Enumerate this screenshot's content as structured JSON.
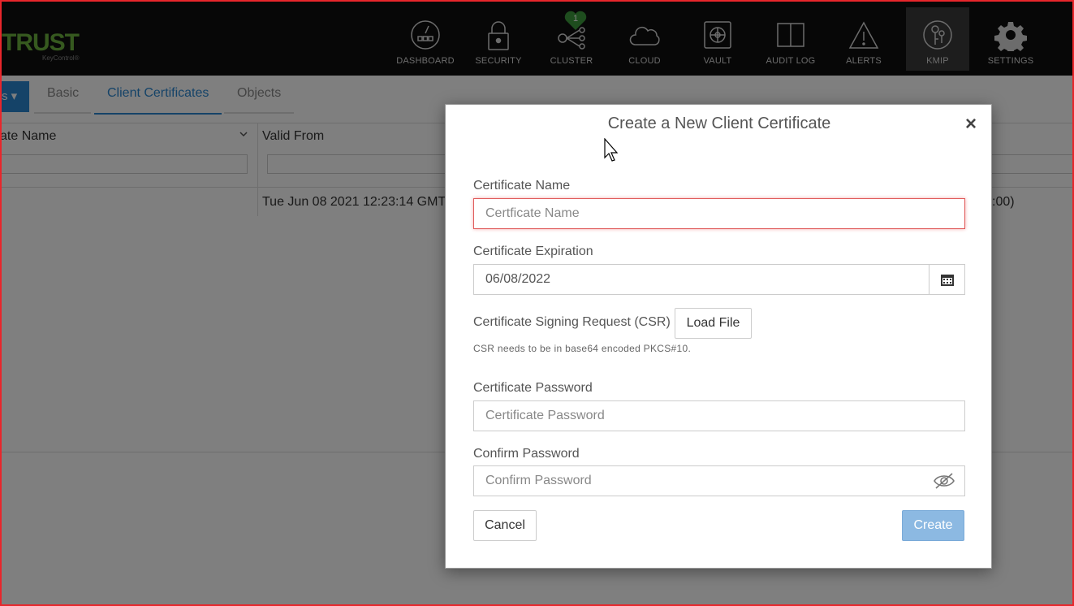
{
  "logo": {
    "text": "TRUST",
    "sub": "KeyControl®"
  },
  "nav": {
    "items": [
      {
        "id": "dashboard",
        "label": "DASHBOARD",
        "icon": "dashboard-gauge-icon"
      },
      {
        "id": "security",
        "label": "SECURITY",
        "icon": "padlock-icon"
      },
      {
        "id": "cluster",
        "label": "CLUSTER",
        "icon": "cluster-nodes-icon",
        "badge": "1"
      },
      {
        "id": "cloud",
        "label": "CLOUD",
        "icon": "cloud-icon"
      },
      {
        "id": "vault",
        "label": "VAULT",
        "icon": "vault-icon"
      },
      {
        "id": "audit",
        "label": "AUDIT LOG",
        "icon": "book-icon"
      },
      {
        "id": "alerts",
        "label": "ALERTS",
        "icon": "warning-triangle-icon"
      },
      {
        "id": "kmip",
        "label": "KMIP",
        "icon": "kmip-keys-icon",
        "active": true
      },
      {
        "id": "settings",
        "label": "SETTINGS",
        "icon": "gear-icon"
      }
    ],
    "badge_color": "#3c9a3c"
  },
  "page": {
    "action_label": "s",
    "tabs": [
      "Basic",
      "Client Certificates",
      "Objects"
    ],
    "active_tab": "Client Certificates",
    "columns": [
      "ate Name",
      "Valid From"
    ],
    "row": {
      "valid_from": "Tue Jun 08 2021 12:23:14 GMT-",
      "right_fragment": ":00)"
    }
  },
  "modal": {
    "title": "Create a New Client Certificate",
    "close": "×",
    "cert_name": {
      "label": "Certificate Name",
      "placeholder": "Certficate Name",
      "value": ""
    },
    "expiration": {
      "label": "Certificate Expiration",
      "value": "06/08/2022"
    },
    "csr": {
      "label": "Certificate Signing Request (CSR)",
      "button": "Load File",
      "help": "CSR needs to be in base64 encoded PKCS#10."
    },
    "password": {
      "label": "Certificate Password",
      "placeholder": "Certificate Password"
    },
    "confirm": {
      "label": "Confirm Password",
      "placeholder": "Confirm Password"
    },
    "cancel": "Cancel",
    "create": "Create"
  },
  "colors": {
    "accent": "#2a86d1",
    "create_disabled": "#8cb9e2",
    "frame": "#e8262b",
    "focus_border": "#e05a5a"
  }
}
